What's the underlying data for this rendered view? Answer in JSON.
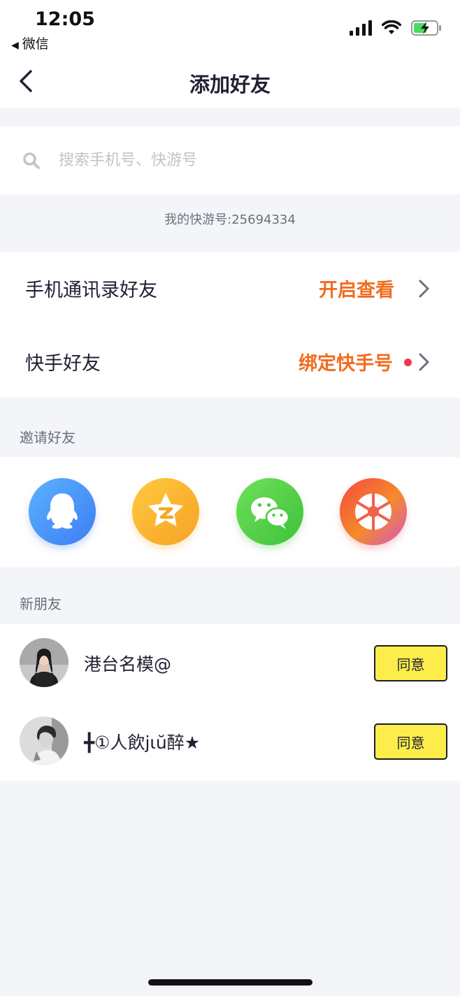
{
  "status_bar": {
    "time": "12:05",
    "back_app": "微信",
    "back_glyph": "◀",
    "icons": [
      "signal-icon",
      "wifi-icon",
      "battery-charging-icon"
    ]
  },
  "nav": {
    "title": "添加好友",
    "back_icon": "chevron-left-icon"
  },
  "search": {
    "placeholder": "搜索手机号、快游号",
    "value": "",
    "icon": "search-icon"
  },
  "my_id": "我的快游号:25694334",
  "rows": [
    {
      "label": "手机通讯录好友",
      "action": "开启查看"
    },
    {
      "label": "快手好友",
      "action": "绑定快手号",
      "has_dot": true
    }
  ],
  "invite": {
    "title": "邀请好友",
    "channels": [
      "qq-icon",
      "qzone-icon",
      "wechat-icon",
      "moments-icon"
    ]
  },
  "new_friends": {
    "title": "新朋友",
    "items": [
      {
        "name": "港台名模@",
        "button": "同意"
      },
      {
        "name": "╋①人飲jιŭ醉★",
        "button": "同意"
      }
    ]
  },
  "colors": {
    "accent_orange": "#f36c20",
    "button_yellow": "#fded4b",
    "page_bg": "#f4f5f9",
    "dot_red": "#f2364d"
  }
}
